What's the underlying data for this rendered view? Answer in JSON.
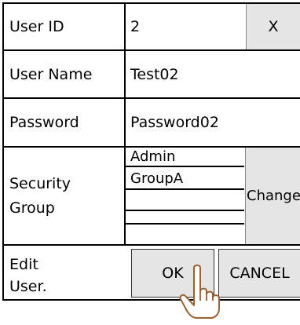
{
  "dialog": {
    "close_label": "X",
    "user_id": {
      "label": "User ID",
      "value": "2"
    },
    "user_name": {
      "label": "User Name",
      "value": "Test02"
    },
    "password": {
      "label": "Password",
      "value": "Password02"
    },
    "security_group": {
      "label_line1": "Security",
      "label_line2": "Group",
      "groups": [
        "Admin",
        "GroupA",
        "",
        ""
      ],
      "change_label": "Change"
    },
    "footer": {
      "label_line1": "Edit",
      "label_line2": "User.",
      "ok_label": "OK",
      "cancel_label": "CANCEL"
    }
  }
}
